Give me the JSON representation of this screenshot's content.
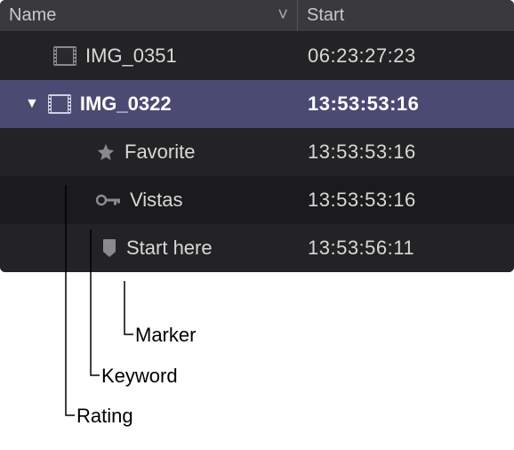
{
  "header": {
    "name_label": "Name",
    "start_label": "Start",
    "sort_glyph": "˅"
  },
  "rows": [
    {
      "label": "IMG_0351",
      "start": "06:23:27:23"
    },
    {
      "label": "IMG_0322",
      "start": "13:53:53:16"
    },
    {
      "label": "Favorite",
      "start": "13:53:53:16"
    },
    {
      "label": "Vistas",
      "start": "13:53:53:16"
    },
    {
      "label": "Start here",
      "start": "13:53:56:11"
    }
  ],
  "callouts": {
    "marker": "Marker",
    "keyword": "Keyword",
    "rating": "Rating"
  },
  "colors": {
    "selected": "#4b4a72",
    "icon_gray": "#8a8a8d"
  }
}
